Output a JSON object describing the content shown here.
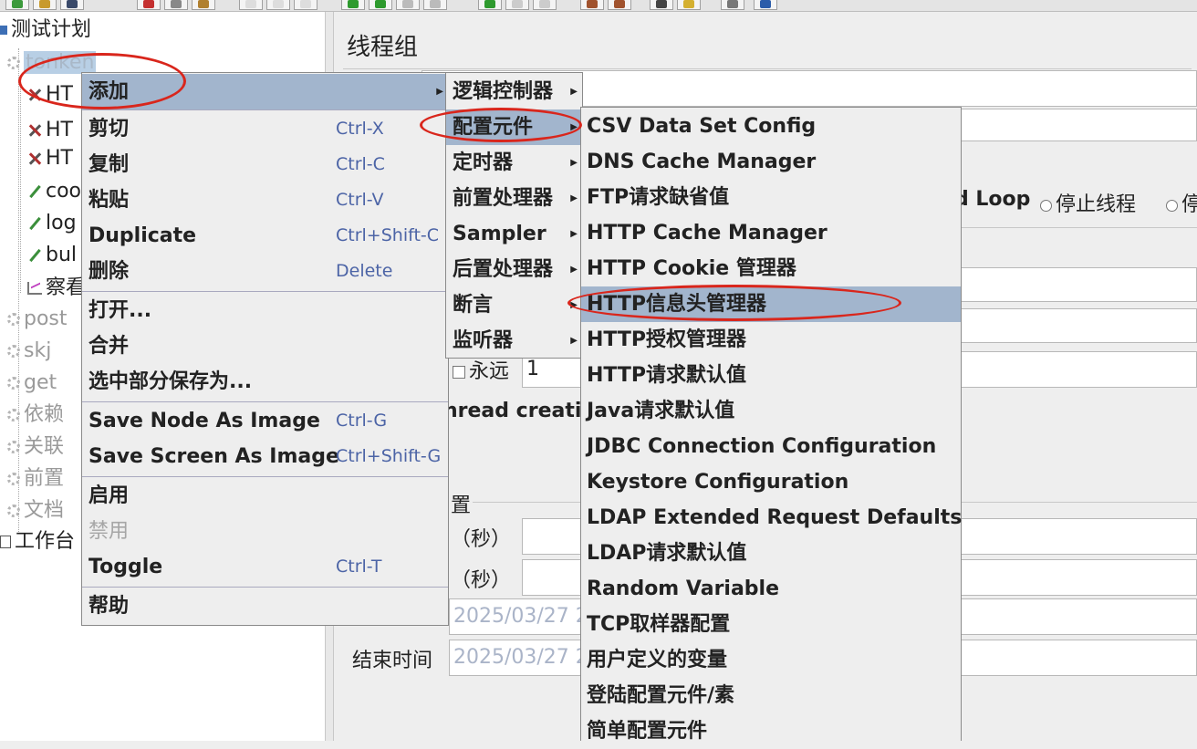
{
  "tree": {
    "items": [
      {
        "label": "测试计划"
      },
      {
        "label": "tonken"
      },
      {
        "label": "HT"
      },
      {
        "label": "HT"
      },
      {
        "label": "HT"
      },
      {
        "label": "coo"
      },
      {
        "label": "log"
      },
      {
        "label": "bul"
      },
      {
        "label": "察看"
      },
      {
        "label": "post"
      },
      {
        "label": "skj"
      },
      {
        "label": "get"
      },
      {
        "label": "依赖"
      },
      {
        "label": "关联"
      },
      {
        "label": "前置"
      },
      {
        "label": "文档"
      },
      {
        "label": "工作台"
      }
    ]
  },
  "panel": {
    "title": "线程组",
    "radio_visible": "d Loop",
    "stop_thread": "停止线程",
    "stop_test_partial": "停",
    "forever_label": "永远",
    "loop_count": "1",
    "thread_creation": "hread creati",
    "scheduler_partial": "置",
    "duration_label": "（秒）",
    "delay_label": "（秒）",
    "start_time": "2025/03/27 2",
    "end_label": "结束时间",
    "end_time": "2025/03/27 2"
  },
  "context_menu": {
    "items": [
      {
        "label": "添加",
        "shortcut": ""
      },
      {
        "label": "剪切",
        "shortcut": "Ctrl-X"
      },
      {
        "label": "复制",
        "shortcut": "Ctrl-C"
      },
      {
        "label": "粘贴",
        "shortcut": "Ctrl-V"
      },
      {
        "label": "Duplicate",
        "shortcut": "Ctrl+Shift-C"
      },
      {
        "label": "删除",
        "shortcut": "Delete"
      },
      {
        "label": "打开...",
        "shortcut": ""
      },
      {
        "label": "合并",
        "shortcut": ""
      },
      {
        "label": "选中部分保存为...",
        "shortcut": ""
      },
      {
        "label": "Save Node As Image",
        "shortcut": "Ctrl-G"
      },
      {
        "label": "Save Screen As Image",
        "shortcut": "Ctrl+Shift-G"
      },
      {
        "label": "启用",
        "shortcut": ""
      },
      {
        "label": "禁用",
        "shortcut": ""
      },
      {
        "label": "Toggle",
        "shortcut": "Ctrl-T"
      },
      {
        "label": "帮助",
        "shortcut": ""
      }
    ]
  },
  "add_submenu": {
    "items": [
      {
        "label": "逻辑控制器"
      },
      {
        "label": "配置元件"
      },
      {
        "label": "定时器"
      },
      {
        "label": "前置处理器"
      },
      {
        "label": "Sampler"
      },
      {
        "label": "后置处理器"
      },
      {
        "label": "断言"
      },
      {
        "label": "监听器"
      }
    ]
  },
  "config_submenu": {
    "items": [
      {
        "label": "CSV Data Set Config"
      },
      {
        "label": "DNS Cache Manager"
      },
      {
        "label": "FTP请求缺省值"
      },
      {
        "label": "HTTP Cache Manager"
      },
      {
        "label": "HTTP Cookie 管理器"
      },
      {
        "label": "HTTP信息头管理器"
      },
      {
        "label": "HTTP授权管理器"
      },
      {
        "label": "HTTP请求默认值"
      },
      {
        "label": "Java请求默认值"
      },
      {
        "label": "JDBC Connection Configuration"
      },
      {
        "label": "Keystore Configuration"
      },
      {
        "label": "LDAP Extended Request Defaults"
      },
      {
        "label": "LDAP请求默认值"
      },
      {
        "label": "Random Variable"
      },
      {
        "label": "TCP取样器配置"
      },
      {
        "label": "用户定义的变量"
      },
      {
        "label": "登陆配置元件/素"
      },
      {
        "label": "简单配置元件"
      }
    ]
  },
  "colors": {
    "highlight": "#a2b5cd",
    "annotation": "#d9261c",
    "shortcut": "#4c64a6"
  }
}
